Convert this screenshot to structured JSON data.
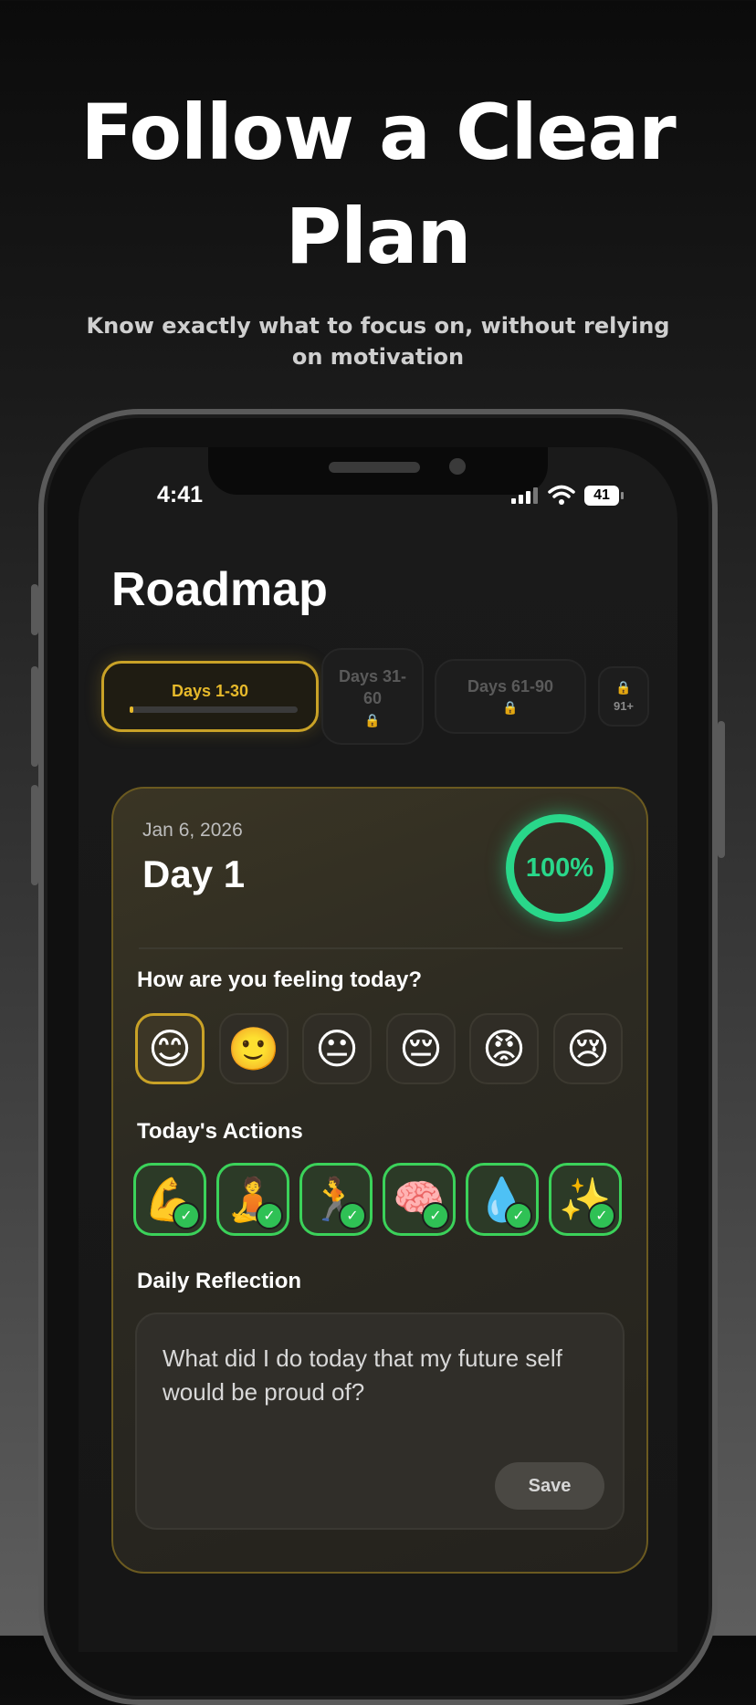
{
  "hero": {
    "title_line1": "Follow a Clear",
    "title_line2": "Plan",
    "subtitle": "Know exactly what to focus on, without relying on motivation"
  },
  "status_bar": {
    "time": "4:41",
    "battery": "41"
  },
  "page": {
    "title": "Roadmap"
  },
  "tabs": [
    {
      "label": "Days 1-30",
      "active": true,
      "progress": 0.02
    },
    {
      "label": "Days 31-60",
      "locked": true
    },
    {
      "label": "Days 61-90",
      "locked": true
    },
    {
      "label": "91+",
      "locked": true
    }
  ],
  "day_card": {
    "date": "Jan 6, 2026",
    "day_label": "Day 1",
    "completion": "100%",
    "mood_question": "How are you feeling today?",
    "moods": [
      {
        "emoji": "😊",
        "name": "happy",
        "selected": true
      },
      {
        "emoji": "🙂",
        "name": "slightly-smiling",
        "selected": false
      },
      {
        "emoji": "😐",
        "name": "neutral",
        "selected": false
      },
      {
        "emoji": "😔",
        "name": "pensive",
        "selected": false
      },
      {
        "emoji": "😡",
        "name": "angry",
        "selected": false
      },
      {
        "emoji": "😢",
        "name": "crying",
        "selected": false
      }
    ],
    "actions_label": "Today's Actions",
    "actions": [
      {
        "emoji": "💪",
        "name": "workout",
        "done": true
      },
      {
        "emoji": "🧘",
        "name": "meditate",
        "done": true
      },
      {
        "emoji": "🏃",
        "name": "run",
        "done": true
      },
      {
        "emoji": "🧠",
        "name": "learn",
        "done": true
      },
      {
        "emoji": "💧",
        "name": "hydrate",
        "done": true
      },
      {
        "emoji": "✨",
        "name": "sparkle",
        "done": true
      }
    ],
    "reflection_label": "Daily Reflection",
    "reflection_placeholder": "What did I do today that my future self would be proud of?",
    "save_label": "Save"
  },
  "colors": {
    "accent_gold": "#e6b92b",
    "success_green": "#29d78a",
    "action_border": "#3bd25a"
  }
}
